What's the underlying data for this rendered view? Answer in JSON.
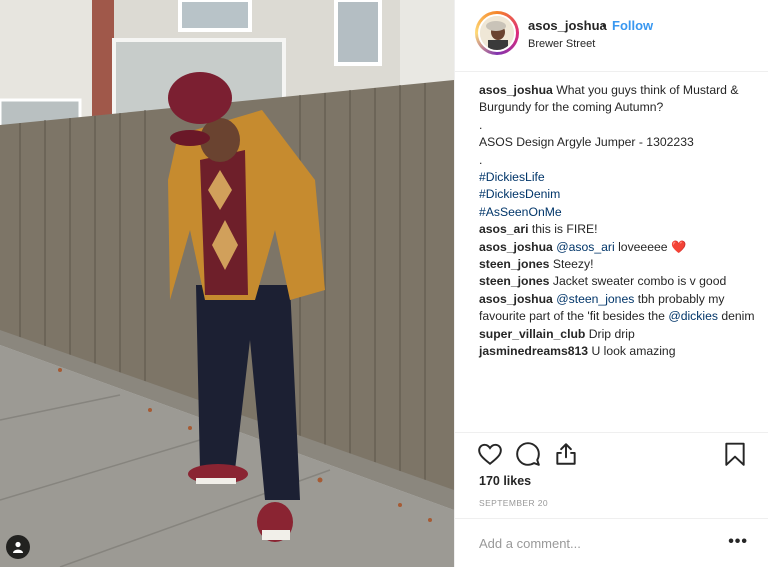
{
  "header": {
    "username": "asos_joshua",
    "separator": "•",
    "follow_label": "Follow",
    "location": "Brewer Street"
  },
  "caption": {
    "username": "asos_joshua",
    "text": "What you guys think of Mustard & Burgundy for the coming Autumn?",
    "dot1": ".",
    "product": "ASOS Design Argyle Jumper - 1302233",
    "dot2": ".",
    "hashtags": [
      "#DickiesLife",
      "#DickiesDenim",
      "#AsSeenOnMe"
    ]
  },
  "comments": [
    {
      "user": "asos_ari",
      "text": "this is FIRE!"
    },
    {
      "user": "asos_joshua",
      "mention": "@asos_ari",
      "text": "loveeeee",
      "emoji": "❤️"
    },
    {
      "user": "steen_jones",
      "text": "Steezy!"
    },
    {
      "user": "steen_jones",
      "text": "Jacket sweater combo is v good"
    },
    {
      "user": "asos_joshua",
      "mention": "@steen_jones",
      "text": "tbh probably my favourite part of the 'fit besides the",
      "mention2": "@dickies",
      "text2": "denim"
    },
    {
      "user": "super_villain_club",
      "text": "Drip drip"
    },
    {
      "user": "jasminedreams813",
      "text": "U look amazing"
    }
  ],
  "actions": {
    "icons": [
      "heart-icon",
      "comment-icon",
      "share-icon",
      "bookmark-icon"
    ]
  },
  "likes": "170 likes",
  "date": "SEPTEMBER 20",
  "add_comment": {
    "placeholder": "Add a comment...",
    "more": "•••"
  }
}
